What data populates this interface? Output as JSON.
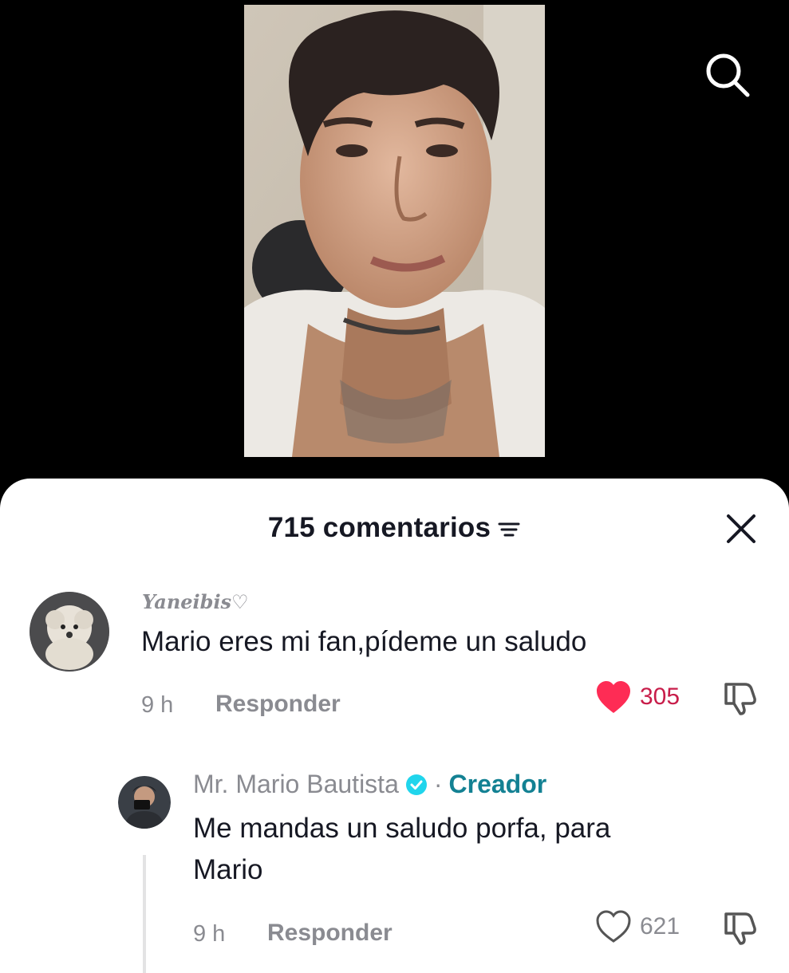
{
  "header": {
    "comment_count": "715 comentarios",
    "sort_icon": "sort-lines-icon",
    "close_icon": "close-x-icon"
  },
  "top_bar": {
    "search_icon": "search-icon"
  },
  "comments": [
    {
      "username": "Yaneibis♡",
      "text": "Mario eres mi fan,pídeme un saludo",
      "time": "9 h",
      "reply_label": "Responder",
      "likes": "305",
      "liked": true
    }
  ],
  "reply": {
    "username": "Mr. Mario Bautista",
    "separator": "·",
    "creator_label": "Creador",
    "text_line1": "Me mandas un saludo porfa, para",
    "text_line2": "Mario",
    "time": "9 h",
    "reply_label": "Responder",
    "likes": "621",
    "liked": false
  },
  "colors": {
    "like_active": "#fe2c55",
    "creator": "#138193",
    "verified": "#20d5ec",
    "muted": "#8a8b91",
    "text": "#161823"
  }
}
